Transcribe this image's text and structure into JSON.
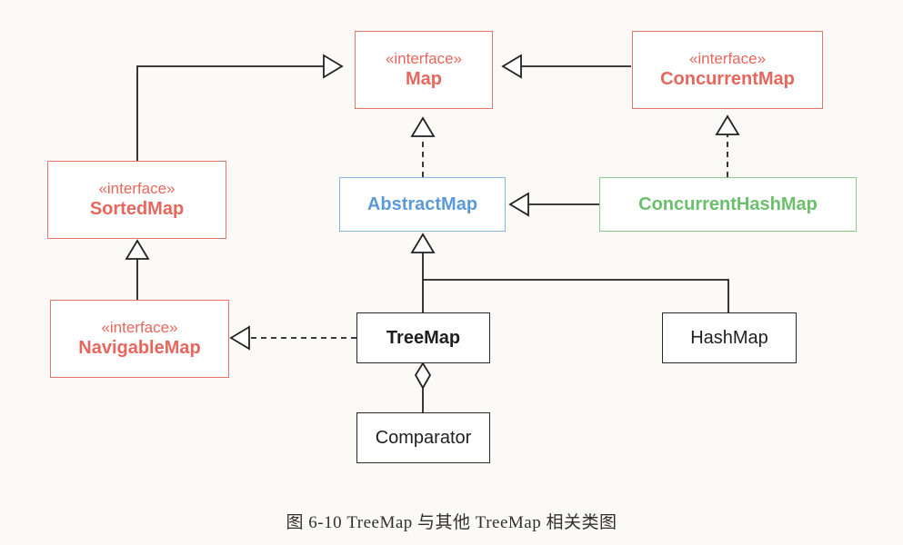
{
  "stereotype": "«interface»",
  "nodes": {
    "map": {
      "name": "Map"
    },
    "concurrent_map": {
      "name": "ConcurrentMap"
    },
    "sorted_map": {
      "name": "SortedMap"
    },
    "abstract_map": {
      "name": "AbstractMap"
    },
    "concurrent_hash_map": {
      "name": "ConcurrentHashMap"
    },
    "navigable_map": {
      "name": "NavigableMap"
    },
    "tree_map": {
      "name": "TreeMap"
    },
    "hash_map": {
      "name": "HashMap"
    },
    "comparator": {
      "name": "Comparator"
    }
  },
  "colors": {
    "interface": "#e6675d",
    "abstract": "#5b9ad9",
    "concurrent_impl": "#6cbf6c",
    "class": "#1f1f1f",
    "line": "#222222"
  },
  "relations": [
    {
      "from": "sorted_map",
      "to": "map",
      "type": "generalization"
    },
    {
      "from": "concurrent_map",
      "to": "map",
      "type": "generalization"
    },
    {
      "from": "abstract_map",
      "to": "map",
      "type": "realization"
    },
    {
      "from": "concurrent_hash_map",
      "to": "concurrent_map",
      "type": "realization"
    },
    {
      "from": "concurrent_hash_map",
      "to": "abstract_map",
      "type": "generalization"
    },
    {
      "from": "navigable_map",
      "to": "sorted_map",
      "type": "generalization"
    },
    {
      "from": "tree_map",
      "to": "abstract_map",
      "type": "generalization"
    },
    {
      "from": "hash_map",
      "to": "abstract_map",
      "type": "generalization"
    },
    {
      "from": "tree_map",
      "to": "navigable_map",
      "type": "realization"
    },
    {
      "from": "tree_map",
      "to": "comparator",
      "type": "aggregation"
    }
  ],
  "caption": "图 6-10  TreeMap 与其他 TreeMap 相关类图"
}
